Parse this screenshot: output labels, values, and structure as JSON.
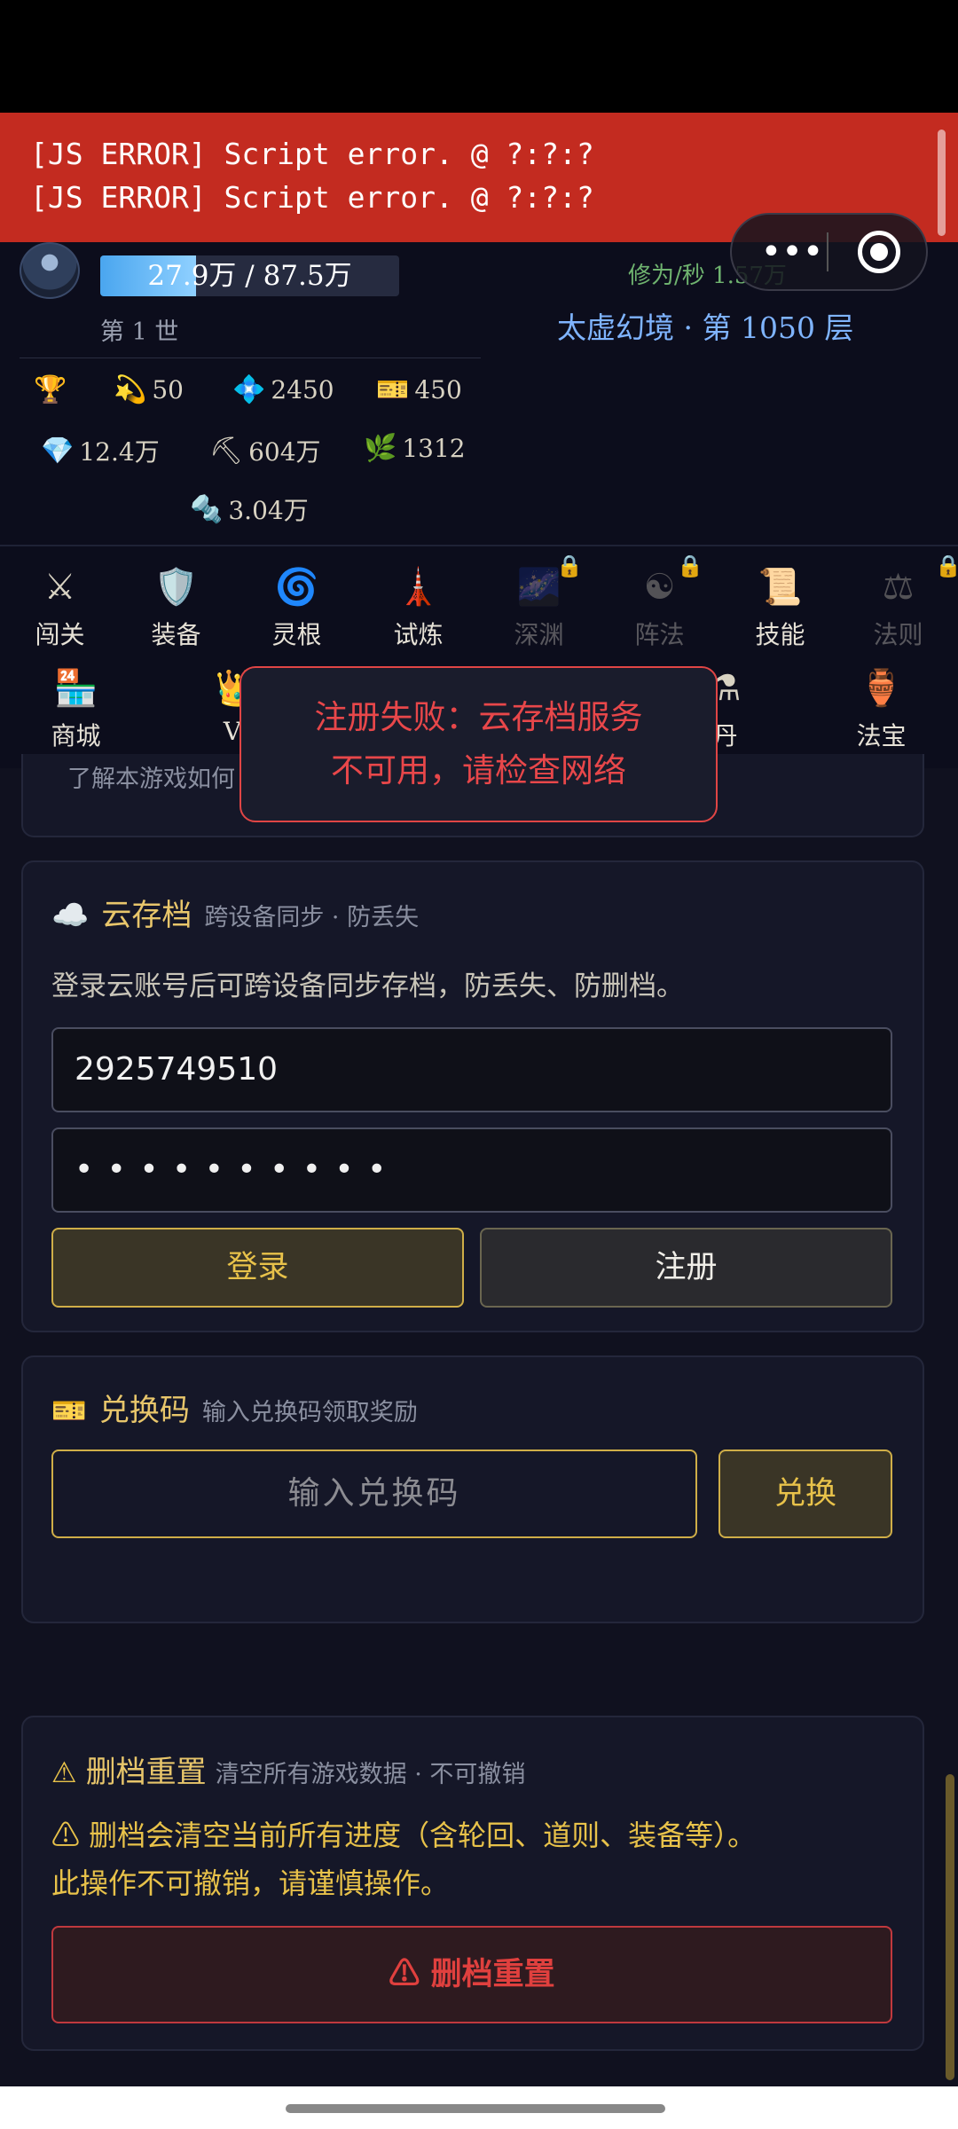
{
  "error_banner": {
    "lines": [
      "[JS ERROR] Script error. @ ?:?:?",
      "[JS ERROR] Script error. @ ?:?:?"
    ]
  },
  "header": {
    "exp_text": "27.9万 / 87.5万",
    "exp_progress": 0.319,
    "generation": "第 1 世",
    "rate": "修为/秒 1.57万",
    "realm": "太虚幻境 · 第 1050 层"
  },
  "stats": [
    {
      "icon": "trophy-icon",
      "glyph": "🏆",
      "value": ""
    },
    {
      "icon": "sparkle-icon",
      "glyph": "💫",
      "value": "50"
    },
    {
      "icon": "crystal-icon",
      "glyph": "💠",
      "value": "2450"
    },
    {
      "icon": "ticket-icon",
      "glyph": "🎫",
      "value": "450"
    },
    {
      "icon": "gem-icon",
      "glyph": "💎",
      "value": "12.4万"
    },
    {
      "icon": "pickaxe-icon",
      "glyph": "⛏",
      "value": "604万"
    },
    {
      "icon": "herb-icon",
      "glyph": "🌿",
      "value": "1312"
    },
    {
      "icon": "bolt-icon",
      "glyph": "🔩",
      "value": "3.04万"
    }
  ],
  "nav": {
    "row1": [
      {
        "label": "闯关",
        "glyph": "⚔",
        "locked": false
      },
      {
        "label": "装备",
        "glyph": "🛡️",
        "locked": false
      },
      {
        "label": "灵根",
        "glyph": "🌀",
        "locked": false
      },
      {
        "label": "试炼",
        "glyph": "🗼",
        "locked": false
      },
      {
        "label": "深渊",
        "glyph": "🌌",
        "locked": true
      },
      {
        "label": "阵法",
        "glyph": "☯",
        "locked": true
      },
      {
        "label": "技能",
        "glyph": "📜",
        "locked": false
      },
      {
        "label": "法则",
        "glyph": "⚖",
        "locked": true
      }
    ],
    "row2": [
      {
        "label": "商城",
        "glyph": "🏪"
      },
      {
        "label": "VI",
        "glyph": "👑"
      },
      {
        "label": "丹",
        "glyph": "⚗"
      },
      {
        "label": "法宝",
        "glyph": "🏺"
      }
    ]
  },
  "toast": {
    "line1": "注册失败：云存档服务",
    "line2": "不可用，请检查网络"
  },
  "partial_text": "了解本游戏如何",
  "cloud": {
    "icon": "☁️",
    "title": "云存档",
    "subtitle": "跨设备同步 · 防丢失",
    "desc": "登录云账号后可跨设备同步存档，防丢失、防删档。",
    "account_value": "2925749510",
    "password_mask": "• • • • • • • • • •",
    "login_label": "登录",
    "register_label": "注册"
  },
  "redeem": {
    "icon": "🎫",
    "title": "兑换码",
    "subtitle": "输入兑换码领取奖励",
    "placeholder": "输入兑换码",
    "button_label": "兑换"
  },
  "reset": {
    "icon": "⚠",
    "title": "删档重置",
    "subtitle": "清空所有游戏数据 · 不可撤销",
    "warning_line1": "⚠ 删档会清空当前所有进度（含轮回、道则、装备等）。",
    "warning_line2": "此操作不可撤销，请谨慎操作。",
    "button_label": "⚠ 删档重置"
  },
  "colors": {
    "accent_gold": "#e8c24a",
    "danger_red": "#e0403e",
    "error_banner": "#c32b20",
    "realm_blue": "#7fb4ff"
  }
}
